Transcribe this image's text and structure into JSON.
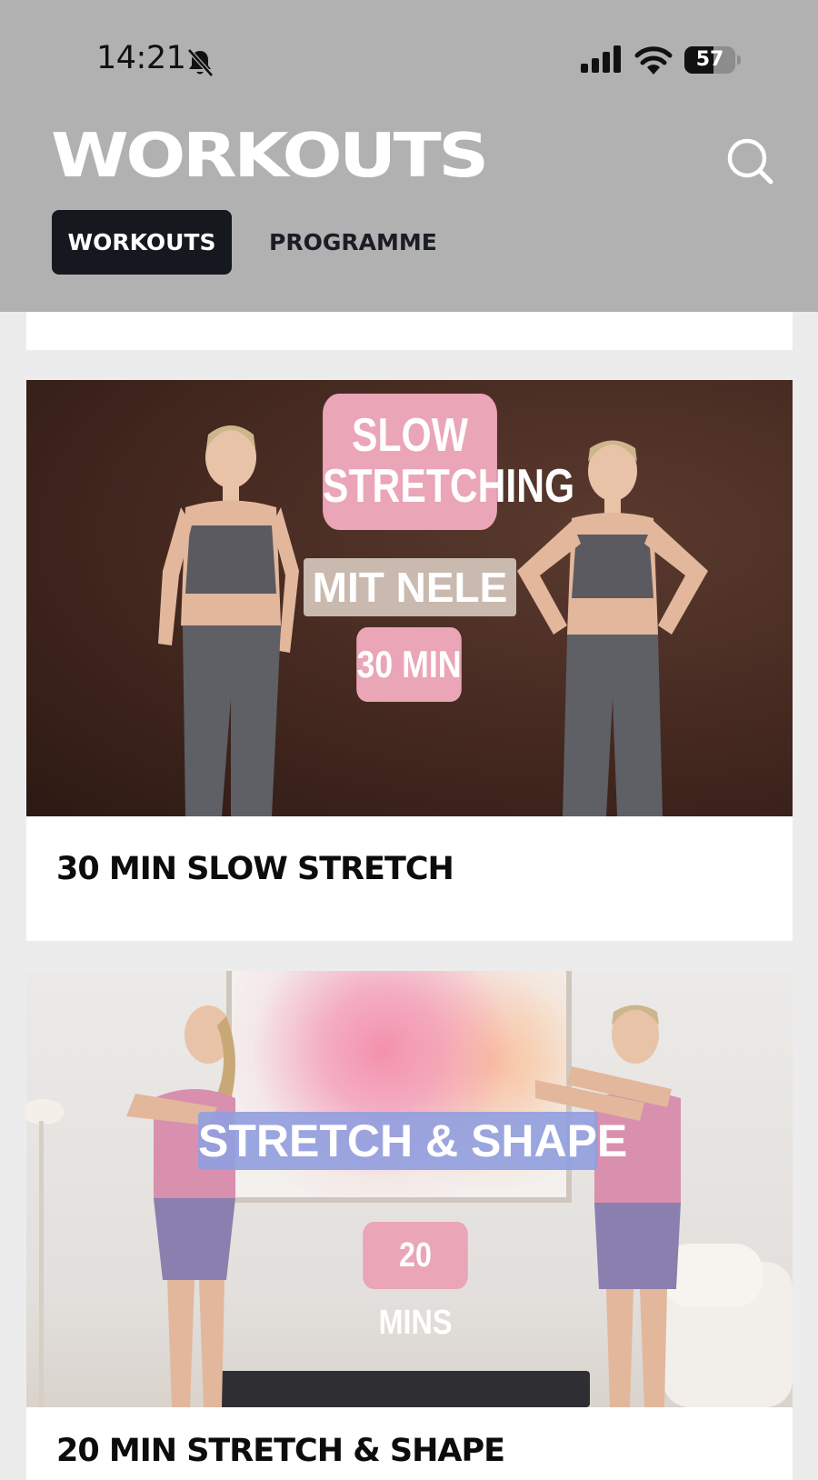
{
  "status_bar": {
    "time": "14:21",
    "battery_level": "57",
    "battery_fraction": 0.57
  },
  "header": {
    "title": "WORKOUTS",
    "search_icon": "search-icon",
    "tabs": [
      {
        "label": "WORKOUTS",
        "active": true
      },
      {
        "label": "PROGRAMME",
        "active": false
      }
    ]
  },
  "workouts": [
    {
      "title": "30 MIN SLOW STRETCH",
      "thumbnail": {
        "line1": "SLOW",
        "line2": "STRETCHING",
        "subtitle": "MIT NELE",
        "duration": "30 MIN"
      }
    },
    {
      "title": "20 MIN STRETCH & SHAPE",
      "thumbnail": {
        "headline": "STRETCH & SHAPE",
        "duration": "20 MINS"
      }
    }
  ],
  "colors": {
    "header_bg": "#b1b1b1",
    "active_tab_bg": "#16181f",
    "page_bg": "#ececec",
    "badge_pink": "#eaa5b7",
    "badge_lavender": "#92a0de"
  }
}
